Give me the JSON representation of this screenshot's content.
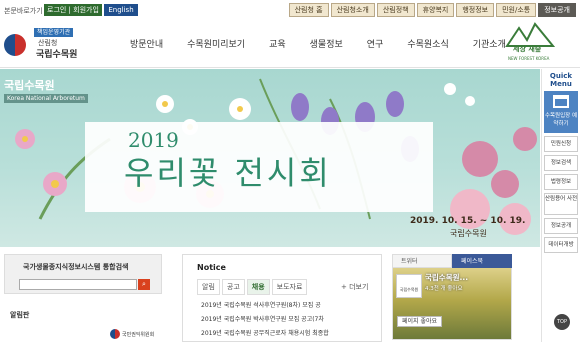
{
  "topbar": {
    "skip_label": "본문바로가기",
    "login_label": "로그인 | 회원가입",
    "english_label": "English",
    "site_tabs": [
      "산림청 홈",
      "산림청소개",
      "산림정책",
      "휴양복지",
      "행정정보",
      "민원/소통",
      "정보공개"
    ]
  },
  "header": {
    "logo_tag": "책임운영기관",
    "logo_sub": "산림청",
    "logo_main": "국립수목원",
    "nav": [
      "방문안내",
      "수목원미리보기",
      "교육",
      "생물정보",
      "연구",
      "수목원소식",
      "기관소개"
    ],
    "ft_logo_text": "세상 새숲",
    "ft_logo_small": "NEW FOREST KOREA"
  },
  "hero": {
    "label_ko": "국립수목원",
    "label_en": "Korea National Arboretum",
    "year": "2019",
    "title": "우리꽃 전시회",
    "date": "2019. 10. 15. ~ 10. 19.",
    "org": "국립수목원"
  },
  "quick_menu": {
    "title": "Quick Menu",
    "highlight": "수목원입장 예약하기",
    "items": [
      "민원신청",
      "정보검색",
      "법령정보",
      "산림용어 사전",
      "정보공개",
      "데이터개방"
    ],
    "top_label": "TOP"
  },
  "search": {
    "title": "국가생물종지식정보시스템 통합검색",
    "placeholder": "",
    "button_icon": "search-icon"
  },
  "alert": {
    "title": "알림판",
    "org_text": "국민권익위원회"
  },
  "notice": {
    "title": "Notice",
    "tabs": [
      "알림",
      "공고",
      "채용",
      "보도자료"
    ],
    "active_tab": "채용",
    "more_label": "+ 더보기",
    "items": [
      "2019년 국립수목원 석사후연구원(8차) 모집 공",
      "2019년 국립수목원 박사후연구원 모집 공고(7차",
      "2019년 국립수목원 공무직근로자 채용시험 최종합"
    ]
  },
  "social": {
    "tabs": [
      "트위터",
      "페이스북"
    ],
    "active_tab": "페이스북",
    "fb_name": "국립수목원...",
    "fb_likes": "4.3천 개 좋아요",
    "fb_profile_label": "국립수목원",
    "fb_like_button": "페이지 좋아요"
  },
  "colors": {
    "accent_green": "#2f8c6c",
    "login_green": "#2e6b2e",
    "english_blue": "#1f4e8c",
    "facebook_blue": "#3b5998"
  }
}
